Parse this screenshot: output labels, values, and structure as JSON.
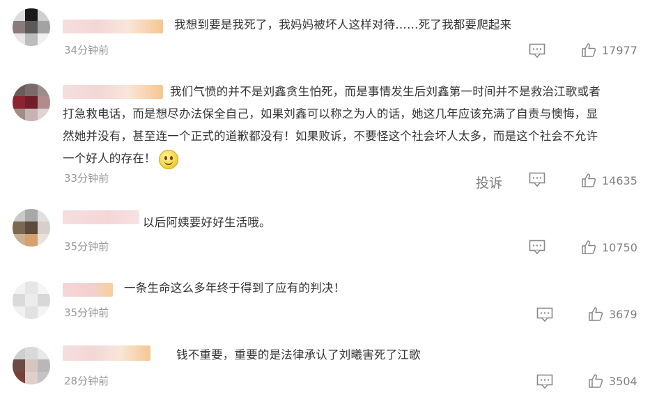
{
  "comments": [
    {
      "text": "我想到要是我死了，我妈妈被坏人这样对待……死了我都要爬起来",
      "time": "34分钟前",
      "likes": "17977",
      "avatar_colors": [
        "#dcdcdc",
        "#1a1a1a",
        "#cfcfcf",
        "#8a7a7a",
        "#5a5a5a",
        "#a3a3a3",
        "#e6e6e6",
        "#bdbdbd",
        "#f0f0f0"
      ]
    },
    {
      "text_line1": "我们气愤的并不是刘鑫贪生怕死，而是事情发生后刘鑫第一时间并不是救治江歌或者",
      "text_line2": "打急救电话，而是想尽办法保全自己，如果刘鑫可以称之为人的话，她这几年应该充满了自责与懊悔，显",
      "text_line3": "然她并没有，甚至连一个正式的道歉都没有！如果败诉，不要怪这个社会坏人太多，而是这个社会不允许",
      "text_line4": "一个好人的存在！",
      "emoji": "smile-emoji",
      "time": "33分钟前",
      "report_label": "投诉",
      "likes": "14635",
      "avatar_colors": [
        "#6b5b5b",
        "#7a6a6a",
        "#9c8c8c",
        "#8b2430",
        "#6e1f28",
        "#b08c8c",
        "#a58a8a",
        "#c9b2b2",
        "#e1d3d3"
      ]
    },
    {
      "text": "以后阿姨要好好生活哦。",
      "time": "35分钟前",
      "likes": "10750",
      "avatar_colors": [
        "#c9c9c9",
        "#a8a8a8",
        "#e0e0e0",
        "#7a6850",
        "#5c4a3a",
        "#d8d0c8",
        "#c8b090",
        "#d6a070",
        "#e9e2da"
      ]
    },
    {
      "text": "一条生命这么多年终于得到了应有的判决！",
      "time": "35分钟前",
      "likes": "3679",
      "avatar_colors": [
        "#f2f2f2",
        "#e6e6e6",
        "#f5f5f5",
        "#dadada",
        "#ececec",
        "#d8d8d8",
        "#f0f0f0",
        "#e2e2e2",
        "#f4f4f4"
      ]
    },
    {
      "text": "钱不重要，重要的是法律承认了刘曦害死了江歌",
      "time": "28分钟前",
      "likes": "3504",
      "avatar_colors": [
        "#cfcfcf",
        "#d9d9d9",
        "#e8e8e8",
        "#6d4a44",
        "#d6c6c0",
        "#b8b8b8",
        "#7a4038",
        "#e0d0cc",
        "#c4c4c4"
      ]
    }
  ],
  "icons": {
    "comment": "comment-icon",
    "like": "thumbs-up-icon"
  },
  "colors": {
    "text": "#333333",
    "muted": "#999999",
    "icon": "#888888"
  }
}
